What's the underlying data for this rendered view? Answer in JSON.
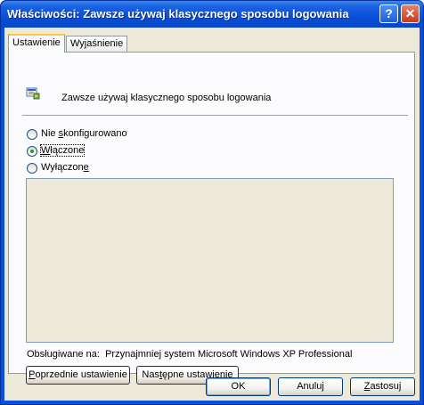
{
  "window": {
    "title": "Właściwości: Zawsze używaj klasycznego sposobu logowania",
    "help_button": "?",
    "close_button": "✕"
  },
  "tabs": [
    {
      "label": "Ustawienie",
      "active": true
    },
    {
      "label": "Wyjaśnienie",
      "active": false
    }
  ],
  "policy": {
    "icon": "policy-setting-icon",
    "name": "Zawsze używaj klasycznego sposobu logowania"
  },
  "options": [
    {
      "label_pre": "Nie ",
      "label_accel": "s",
      "label_post": "konfigurowano",
      "selected": false
    },
    {
      "label_pre": "",
      "label_accel": "W",
      "label_post": "łączone",
      "selected": true
    },
    {
      "label_pre": "Wyłączon",
      "label_accel": "e",
      "label_post": "",
      "selected": false
    }
  ],
  "supported": {
    "label": "Obsługiwane na:",
    "value": "Przynajmniej system Microsoft Windows XP Professional"
  },
  "nav": {
    "prev_accel": "P",
    "prev_rest": "oprzednie ustawienie",
    "next_pre": "Nas",
    "next_accel": "t",
    "next_post": "ępne ustawienie"
  },
  "footer": {
    "ok": "OK",
    "cancel": "Anuluj",
    "apply_accel": "Z",
    "apply_rest": "astosuj"
  }
}
